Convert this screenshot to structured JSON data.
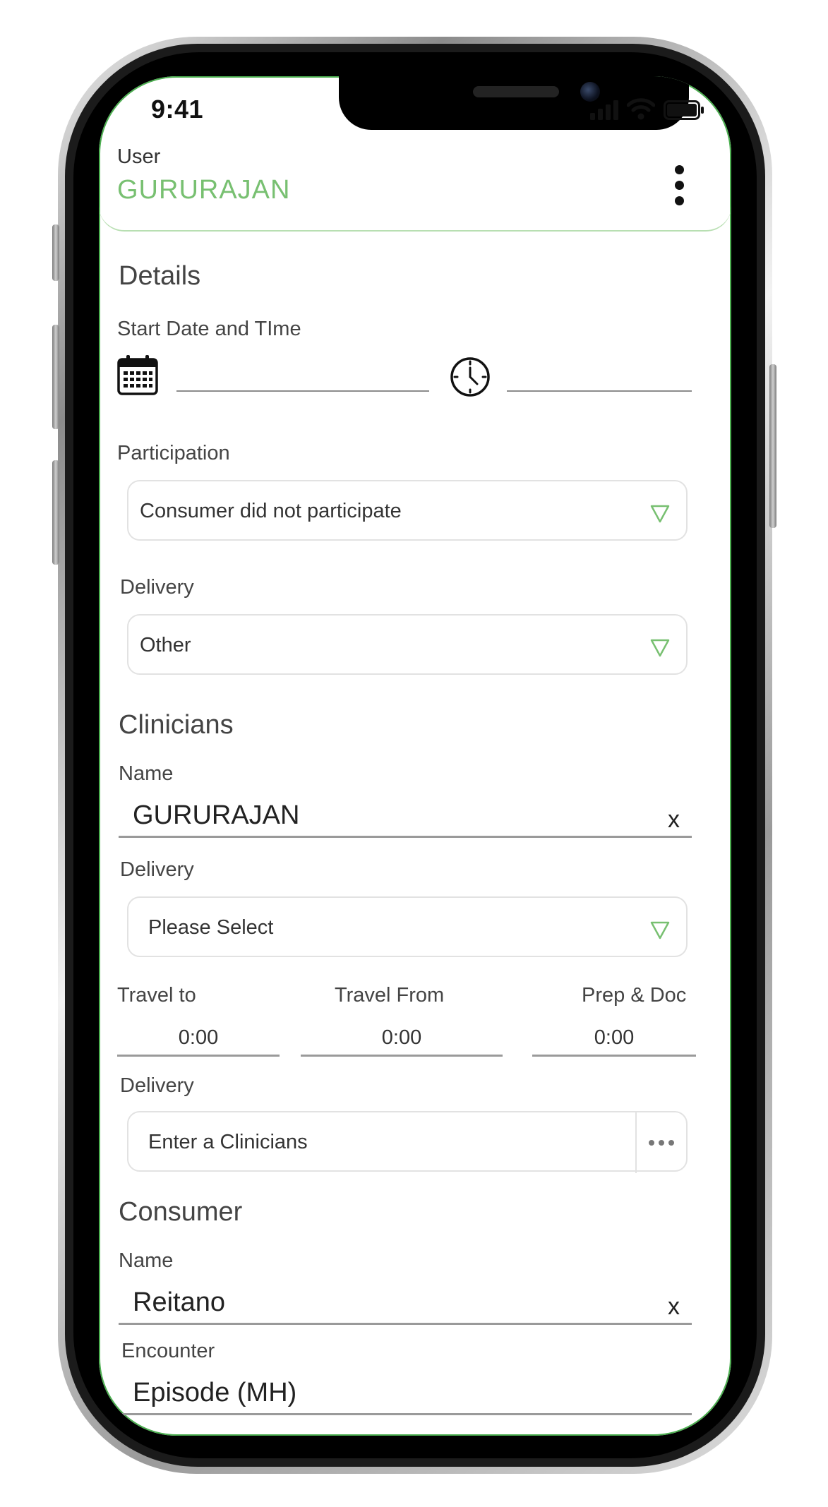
{
  "status_bar": {
    "time": "9:41"
  },
  "header": {
    "user_label": "User",
    "user_name": "GURURAJAN"
  },
  "details": {
    "title": "Details",
    "start_label": "Start Date and TIme",
    "participation_label": "Participation",
    "participation_value": "Consumer did not participate",
    "delivery_label": "Delivery",
    "delivery_value": "Other"
  },
  "clinicians": {
    "title": "Clinicians",
    "name_label": "Name",
    "name_value": "GURURAJAN",
    "clear_label": "x",
    "delivery_label": "Delivery",
    "delivery_value": "Please Select",
    "travel_to_label": "Travel to",
    "travel_to_value": "0:00",
    "travel_from_label": "Travel From",
    "travel_from_value": "0:00",
    "prep_doc_label": "Prep & Doc",
    "prep_doc_value": "0:00",
    "delivery2_label": "Delivery",
    "clinician_placeholder": "Enter a Clinicians"
  },
  "consumer": {
    "title": "Consumer",
    "name_label": "Name",
    "name_value": "Reitano",
    "clear_label": "x",
    "encounter_label": "Encounter",
    "encounter_value": "Episode (MH)"
  },
  "colors": {
    "accent": "#78c071",
    "border": "#e2e2e2",
    "text": "#333333"
  },
  "icons": [
    "calendar-icon",
    "clock-icon",
    "dropdown-triangle-icon",
    "more-vertical-icon",
    "ellipsis-icon",
    "signal-icon",
    "wifi-icon",
    "battery-icon"
  ]
}
